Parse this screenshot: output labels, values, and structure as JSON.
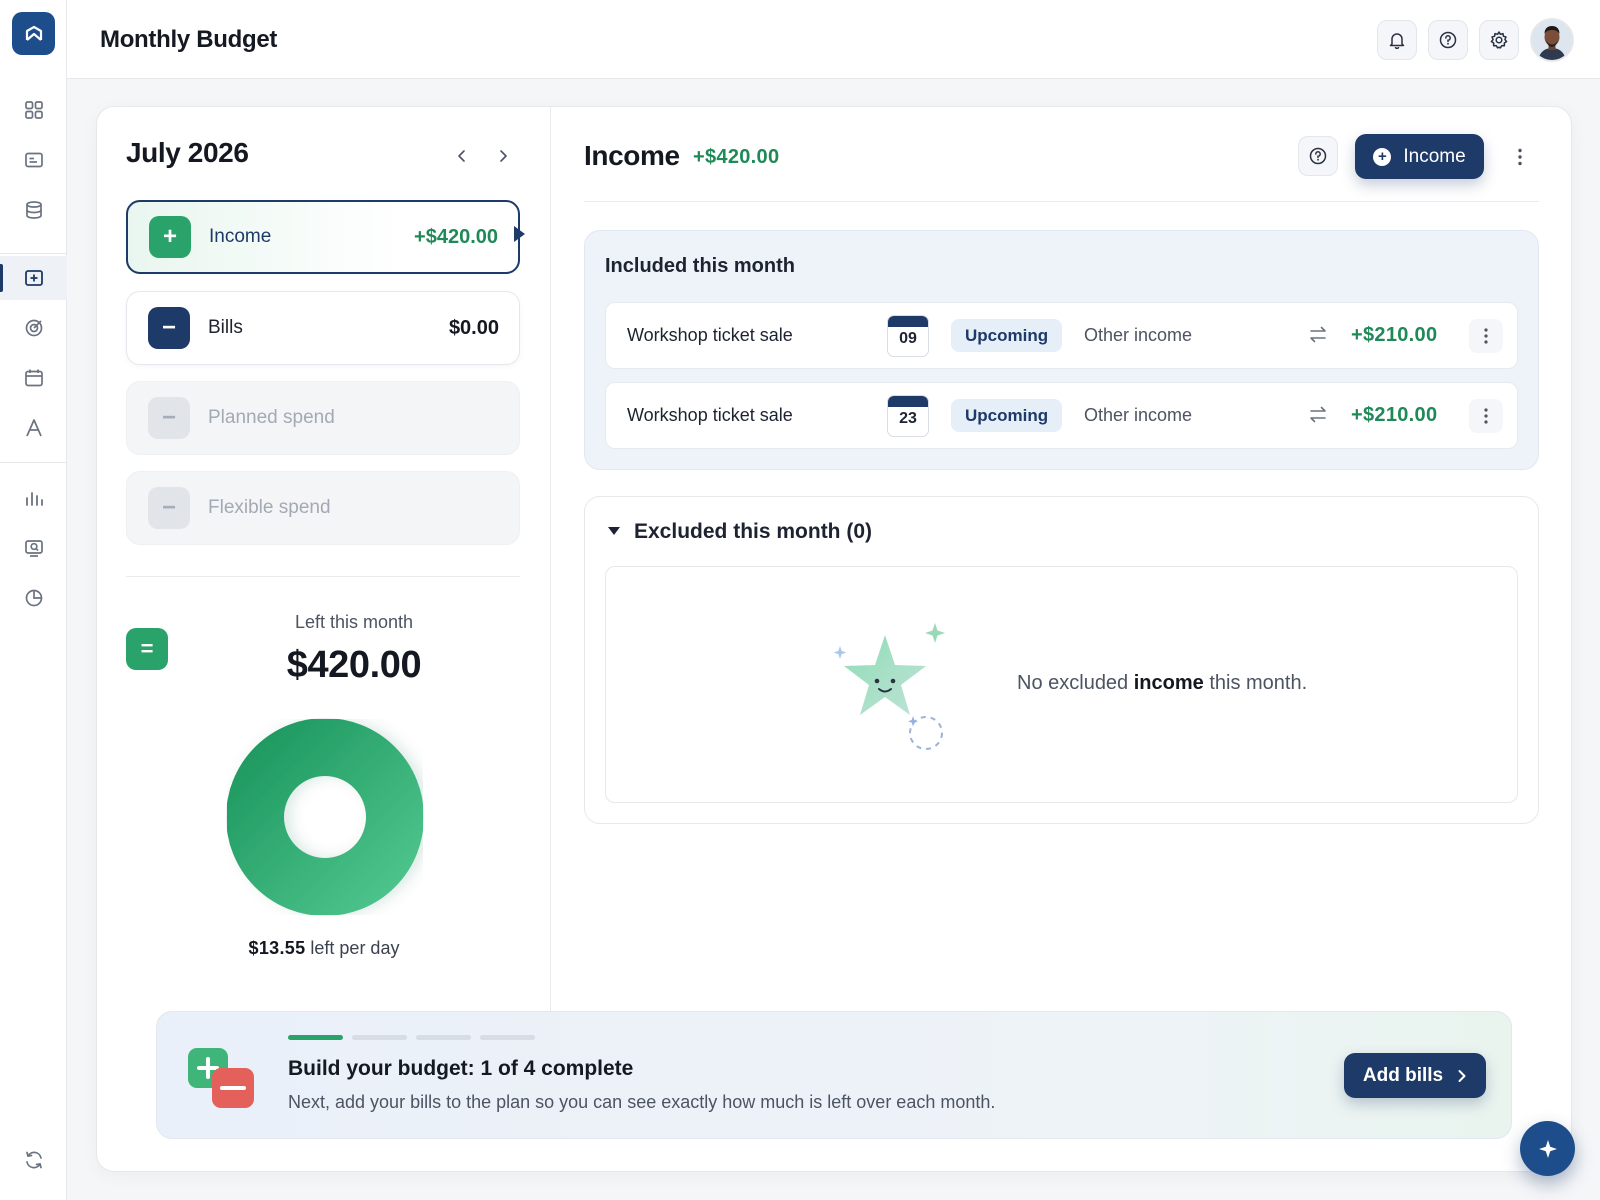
{
  "app": {
    "title": "Monthly Budget"
  },
  "colors": {
    "primary": "#1e3a68",
    "success": "#2aa36a",
    "success_text": "#1f8a57",
    "danger": "#e4605a"
  },
  "rail": {
    "items": [
      {
        "icon": "grid-icon"
      },
      {
        "icon": "card-icon"
      },
      {
        "icon": "database-icon"
      },
      {
        "icon": "budget-plus-icon",
        "active": true
      },
      {
        "icon": "target-icon"
      },
      {
        "icon": "calendar-icon"
      },
      {
        "icon": "font-icon"
      },
      {
        "icon": "bar-chart-icon"
      },
      {
        "icon": "search-report-icon"
      },
      {
        "icon": "pie-chart-icon"
      },
      {
        "icon": "refresh-icon"
      }
    ]
  },
  "header": {
    "icons": [
      "bell-icon",
      "help-icon",
      "gear-icon",
      "avatar"
    ]
  },
  "period": {
    "label": "July 2026"
  },
  "categories": [
    {
      "label": "Income",
      "amount": "+$420.00",
      "state": "selected",
      "sign": "+"
    },
    {
      "label": "Bills",
      "amount": "$0.00",
      "state": "normal",
      "sign": "−"
    },
    {
      "label": "Planned spend",
      "amount": "",
      "state": "disabled",
      "sign": "−"
    },
    {
      "label": "Flexible spend",
      "amount": "",
      "state": "disabled",
      "sign": "−"
    }
  ],
  "summary": {
    "eq_sign": "=",
    "label": "Left this month",
    "amount": "$420.00",
    "per_day_amount": "$13.55",
    "per_day_suffix": "left per day",
    "donut_fill_fraction": 1.0
  },
  "income_panel": {
    "title": "Income",
    "total": "+$420.00",
    "add_button_label": "Income",
    "included_title": "Included this month",
    "transactions": [
      {
        "name": "Workshop ticket sale",
        "day": "09",
        "status": "Upcoming",
        "category": "Other income",
        "amount": "+$210.00"
      },
      {
        "name": "Workshop ticket sale",
        "day": "23",
        "status": "Upcoming",
        "category": "Other income",
        "amount": "+$210.00"
      }
    ],
    "excluded_title": "Excluded this month (0)",
    "empty_prefix": "No excluded ",
    "empty_bold": "income",
    "empty_suffix": " this month."
  },
  "onboarding": {
    "steps_total": 4,
    "steps_done": 1,
    "title": "Build your budget: 1 of 4 complete",
    "subtitle": "Next, add your bills to the plan so you can see exactly how much is left over each month.",
    "button_label": "Add bills"
  }
}
